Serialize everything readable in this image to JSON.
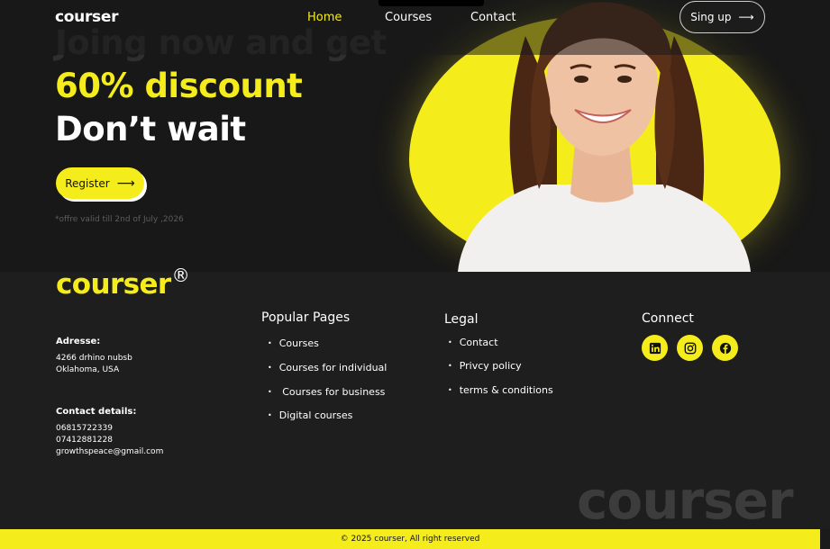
{
  "nav": {
    "logo": "courser",
    "links": [
      "Home",
      "Courses",
      "Contact"
    ],
    "signup_label": "Sing up",
    "arrow": "⟶"
  },
  "hero": {
    "heading_top": "Joing now and get",
    "heading_discount": "60% discount",
    "heading_wait": "Don’t wait",
    "register_label": "Register",
    "arrow": "⟶",
    "offer_note": "*offre valid till 2nd of July ,2026"
  },
  "footer": {
    "logo": "courser",
    "logo_mark": "®",
    "address_label": "Adresse:",
    "address_lines": [
      "4266 drhino nubsb",
      "Oklahoma, USA"
    ],
    "contact_label": "Contact details:",
    "contact_lines": [
      "06815722339",
      "07412881228",
      "growthspeace@gmail.com"
    ],
    "popular": {
      "title": "Popular Pages",
      "items": [
        "Courses",
        "Courses for individual",
        " Courses for business",
        "Digital courses"
      ]
    },
    "legal": {
      "title": "Legal",
      "items": [
        "Contact",
        "Privcy policy",
        "terms & conditions"
      ]
    },
    "connect": {
      "title": "Connect",
      "icons": [
        "linkedin-icon",
        "instagram-icon",
        "facebook-icon"
      ]
    },
    "watermark": "courser",
    "copyright": "© 2025 courser, All right reserved"
  },
  "colors": {
    "accent": "#f5ec1c",
    "background": "#1b1b1b"
  }
}
